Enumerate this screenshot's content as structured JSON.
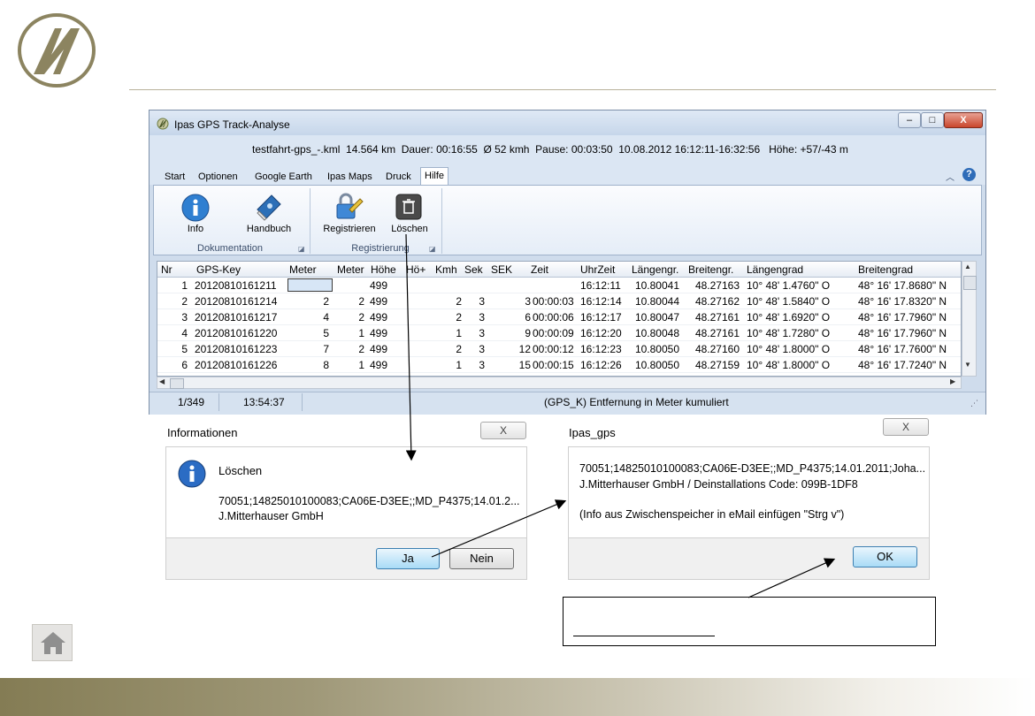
{
  "main_window": {
    "title": "Ipas GPS Track-Analyse",
    "controls": {
      "minimize": "–",
      "maximize": "□",
      "close": "X"
    },
    "summary": "testfahrt-gps_-.kml  14.564 km  Dauer: 00:16:55  Ø 52 kmh  Pause: 00:03:50  10.08.2012 16:12:11-16:32:56   Höhe: +57/-43 m",
    "tabs": [
      "Start",
      "Optionen",
      "Google Earth",
      "Ipas Maps",
      "Druck",
      "Hilfe"
    ],
    "active_tab": "Hilfe",
    "ribbon": {
      "buttons": {
        "info": "Info",
        "handbuch": "Handbuch",
        "registrieren": "Registrieren",
        "loeschen": "Löschen"
      },
      "groups": {
        "dokumentation": "Dokumentation",
        "registrierung": "Registrierung"
      }
    },
    "grid": {
      "columns": [
        "Nr",
        "GPS-Key",
        "Meter",
        "Meter",
        "Höhe",
        "Hö+",
        "Kmh",
        "Sek",
        "SEK",
        "Zeit",
        "UhrZeit",
        "Längengr.",
        "Breitengr.",
        "Längengrad",
        "Breitengrad"
      ],
      "rows": [
        [
          "1",
          "20120810161211",
          "",
          "",
          "499",
          "",
          "",
          "",
          "",
          "",
          "16:12:11",
          "10.80041",
          "48.27163",
          "10° 48' 1.4760\" O",
          "48° 16' 17.8680\" N"
        ],
        [
          "2",
          "20120810161214",
          "2",
          "2",
          "499",
          "",
          "2",
          "3",
          "3",
          "00:00:03",
          "16:12:14",
          "10.80044",
          "48.27162",
          "10° 48' 1.5840\" O",
          "48° 16' 17.8320\" N"
        ],
        [
          "3",
          "20120810161217",
          "4",
          "2",
          "499",
          "",
          "2",
          "3",
          "6",
          "00:00:06",
          "16:12:17",
          "10.80047",
          "48.27161",
          "10° 48' 1.6920\" O",
          "48° 16' 17.7960\" N"
        ],
        [
          "4",
          "20120810161220",
          "5",
          "1",
          "499",
          "",
          "1",
          "3",
          "9",
          "00:00:09",
          "16:12:20",
          "10.80048",
          "48.27161",
          "10° 48' 1.7280\" O",
          "48° 16' 17.7960\" N"
        ],
        [
          "5",
          "20120810161223",
          "7",
          "2",
          "499",
          "",
          "2",
          "3",
          "12",
          "00:00:12",
          "16:12:23",
          "10.80050",
          "48.27160",
          "10° 48' 1.8000\" O",
          "48° 16' 17.7600\" N"
        ],
        [
          "6",
          "20120810161226",
          "8",
          "1",
          "499",
          "",
          "1",
          "3",
          "15",
          "00:00:15",
          "16:12:26",
          "10.80050",
          "48.27159",
          "10° 48' 1.8000\" O",
          "48° 16' 17.7240\" N"
        ]
      ]
    },
    "status": {
      "position": "1/349",
      "time": "13:54:37",
      "message": "(GPS_K)  Entfernung in Meter kumuliert"
    }
  },
  "dialog_info": {
    "title": "Informationen",
    "close": "X",
    "heading": "Löschen",
    "line1": "70051;14825010100083;CA06E-D3EE;;MD_P4375;14.01.2...",
    "line2": "J.Mitterhauser GmbH",
    "yes": "Ja",
    "no": "Nein"
  },
  "dialog_ipas": {
    "title": "Ipas_gps",
    "close": "X",
    "line1": "70051;14825010100083;CA06E-D3EE;;MD_P4375;14.01.2011;Joha...",
    "line2": "J.Mitterhauser GmbH / Deinstallations Code: 099B-1DF8",
    "line3": "(Info aus Zwischenspeicher in eMail einfügen \"Strg v\")",
    "ok": "OK"
  },
  "colors": {
    "accent_gold": "#8c8460",
    "ribbon_blue": "#dbe6f3",
    "selection_blue": "#a9dbf6"
  },
  "icons": [
    "logo-icon",
    "app-icon",
    "info-icon",
    "handbook-icon",
    "register-icon",
    "trash-icon",
    "home-icon",
    "dialog-info-icon"
  ]
}
